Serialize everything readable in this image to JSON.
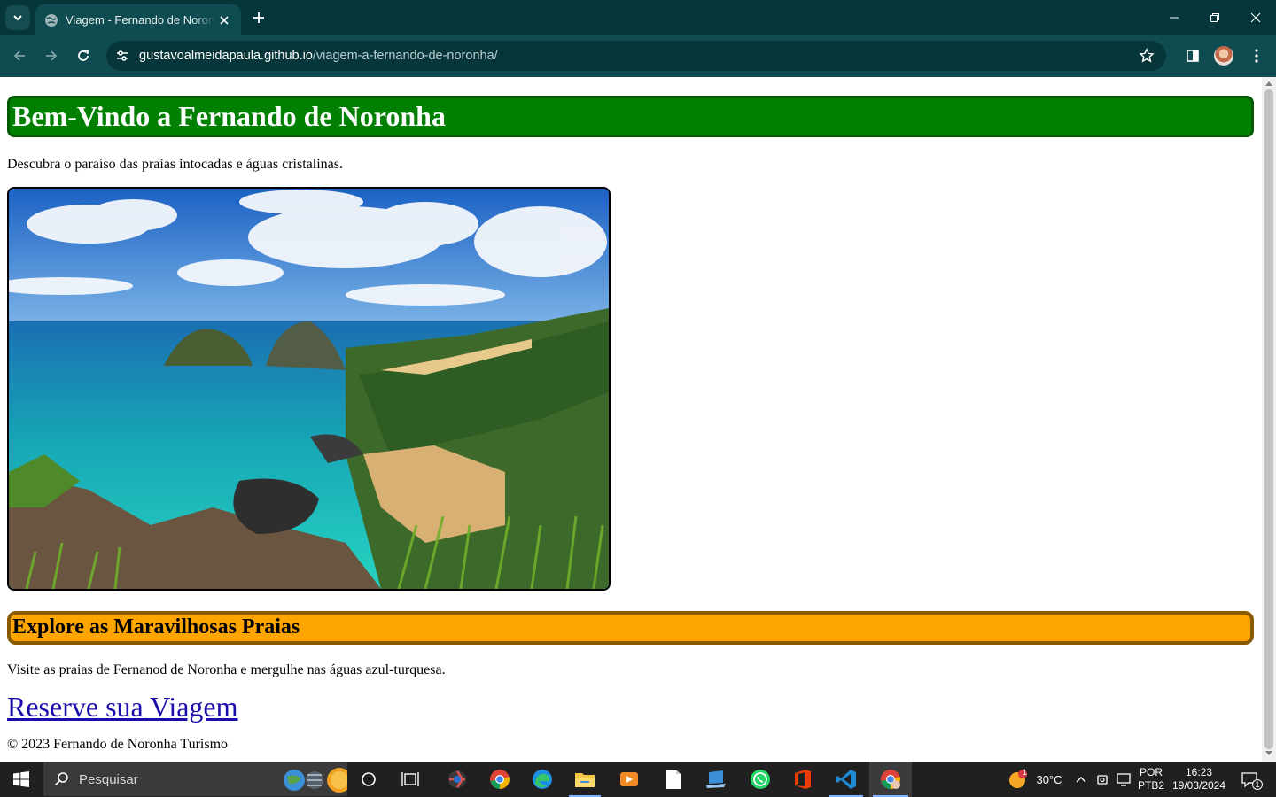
{
  "browser": {
    "tab_title": "Viagem - Fernando de Noronha",
    "url_host": "gustavoalmeidapaula.github.io",
    "url_path": "/viagem-a-fernando-de-noronha/"
  },
  "page": {
    "heading": "Bem-Vindo a Fernando de Noronha",
    "intro": "Descubra o paraíso das praias intocadas e águas cristalinas.",
    "image_alt": "Fernando de Noronha",
    "section_heading": "Explore as Maravilhosas Praias",
    "section_text": "Visite as praias de Fernanod de Noronha e mergulhe nas águas azul-turquesa.",
    "cta_link": "Reserve sua Viagem",
    "footer": "© 2023 Fernando de Noronha Turismo"
  },
  "taskbar": {
    "search_placeholder": "Pesquisar",
    "weather_temp": "30°C",
    "weather_badge": "1",
    "language": "POR",
    "keyboard": "PTB2",
    "time": "16:23",
    "date": "19/03/2024",
    "notification_count": "1"
  },
  "colors": {
    "chrome_dark": "#06363a",
    "chrome_toolbar": "#0f4c51",
    "heading_bg": "#008000",
    "section_bg": "#ffa500",
    "taskbar_bg": "#202020"
  }
}
